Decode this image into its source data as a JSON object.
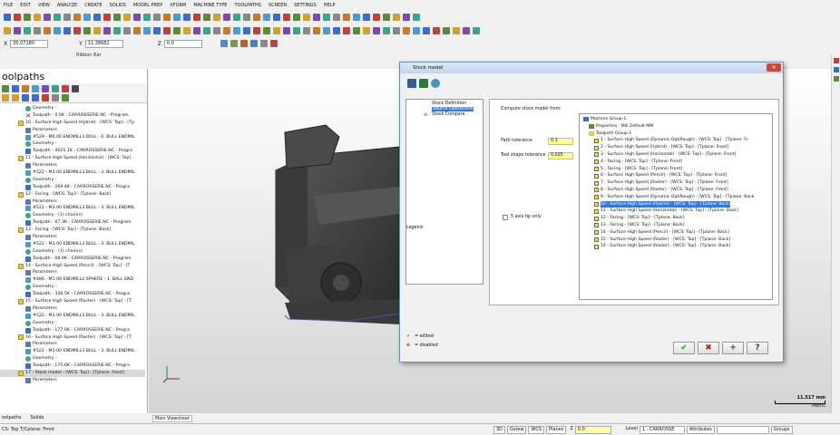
{
  "menu": [
    "FILE",
    "EDIT",
    "VIEW",
    "ANALYZE",
    "CREATE",
    "SOLIDS",
    "MODEL PREP",
    "XFORM",
    "MACHINE TYPE",
    "TOOLPATHS",
    "SCREEN",
    "SETTINGS",
    "HELP"
  ],
  "coords": {
    "x_label": "X",
    "x_value": "35.07180",
    "y_label": "Y",
    "y_value": "11.38682",
    "z_label": "Z",
    "z_value": "0.0"
  },
  "ribbon_label": "Ribbon Bar",
  "left_panel": {
    "title": "oolpaths",
    "tree": [
      {
        "icon": "geo",
        "indent": 28,
        "text": "Geometry -"
      },
      {
        "icon": "x",
        "indent": 28,
        "text": "Toolpath - 0.0K - CARROSSERIE.NC - Program"
      },
      {
        "icon": "folder",
        "indent": 20,
        "text": "10 - Surface High Speed (Hybrid) - [WCS: Top] - [Tp"
      },
      {
        "icon": "param",
        "indent": 28,
        "text": "Parameters"
      },
      {
        "icon": "tool",
        "indent": 28,
        "text": "#529 - M6.00 ENDMILL3 BULL - 6. BULL ENDMIL"
      },
      {
        "icon": "geo",
        "indent": 28,
        "text": "Geometry -"
      },
      {
        "icon": "path",
        "indent": 28,
        "text": "Toolpath - 4025.1K - CARROSSERIE.NC - Progra"
      },
      {
        "icon": "folder",
        "indent": 20,
        "text": "11 - Surface High Speed (Horizontal) - [WCS: Top] -"
      },
      {
        "icon": "param",
        "indent": 28,
        "text": "Parameters"
      },
      {
        "icon": "tool",
        "indent": 28,
        "text": "#522 - M3.00 ENDMILL3 BULL - 3. BULL ENDMIL"
      },
      {
        "icon": "geo",
        "indent": 28,
        "text": "Geometry -"
      },
      {
        "icon": "path",
        "indent": 28,
        "text": "Toolpath - 269.4K - CARROSSERIE.NC - Progra"
      },
      {
        "icon": "folder",
        "indent": 20,
        "text": "12 - Facing - [WCS: Top] - [Tplane: Back]"
      },
      {
        "icon": "param",
        "indent": 28,
        "text": "Parameters"
      },
      {
        "icon": "tool",
        "indent": 28,
        "text": "#522 - M3.00 ENDMILL3 BULL - 3. BULL ENDMIL"
      },
      {
        "icon": "geo",
        "indent": 28,
        "text": "Geometry - (1) chain(s)"
      },
      {
        "icon": "path",
        "indent": 28,
        "text": "Toolpath - 67.3K - CARROSSERIE.NC - Program"
      },
      {
        "icon": "folder",
        "indent": 20,
        "text": "13 - Facing - [WCS: Top] - [Tplane: Back]"
      },
      {
        "icon": "param",
        "indent": 28,
        "text": "Parameters"
      },
      {
        "icon": "tool",
        "indent": 28,
        "text": "#522 - M3.00 ENDMILL3 BULL - 3. BULL ENDMIL"
      },
      {
        "icon": "geo",
        "indent": 28,
        "text": "Geometry - (1) chain(s)"
      },
      {
        "icon": "path",
        "indent": 28,
        "text": "Toolpath - 68.9K - CARROSSERIE.NC - Program"
      },
      {
        "icon": "folder",
        "indent": 20,
        "text": "14 - Surface High Speed (Pencil) - [WCS: Top] - [T"
      },
      {
        "icon": "param",
        "indent": 28,
        "text": "Parameters"
      },
      {
        "icon": "tool",
        "indent": 28,
        "text": "#486 - M1.00 ENDMILL2 SPHERE - 1. BALL END"
      },
      {
        "icon": "geo",
        "indent": 28,
        "text": "Geometry -"
      },
      {
        "icon": "path",
        "indent": 28,
        "text": "Toolpath - 336.5K - CARROSSERIE.NC - Progra"
      },
      {
        "icon": "folder",
        "indent": 20,
        "text": "15 - Surface High Speed (Raster) - [WCS: Top] - [T"
      },
      {
        "icon": "param",
        "indent": 28,
        "text": "Parameters"
      },
      {
        "icon": "tool",
        "indent": 28,
        "text": "#522 - M3.00 ENDMILL3 BULL - 3. BULL ENDMIL"
      },
      {
        "icon": "geo",
        "indent": 28,
        "text": "Geometry -"
      },
      {
        "icon": "path",
        "indent": 28,
        "text": "Toolpath - 177.0K - CARROSSERIE.NC - Progra"
      },
      {
        "icon": "folder",
        "indent": 20,
        "text": "16 - Surface High Speed (Raster) - [WCS: Top] - [T"
      },
      {
        "icon": "param",
        "indent": 28,
        "text": "Parameters"
      },
      {
        "icon": "tool",
        "indent": 28,
        "text": "#522 - M3.00 ENDMILL3 BULL - 3. BULL ENDMIL"
      },
      {
        "icon": "geo",
        "indent": 28,
        "text": "Geometry -"
      },
      {
        "icon": "path",
        "indent": 28,
        "text": "Toolpath - 175.6K - CARROSSERIE.NC - Progra"
      },
      {
        "icon": "folder",
        "indent": 20,
        "text": "17 - Stock model - [WCS: Top] - [Tplane: Front]",
        "selected": true
      },
      {
        "icon": "param",
        "indent": 28,
        "text": "Parameters"
      }
    ],
    "tabs": [
      "oolpaths",
      "Solids"
    ]
  },
  "viewport_tab": "Main Viewsheet",
  "dialog": {
    "title": "Stock model",
    "close": "✕",
    "nav": [
      {
        "label": "Stock Definition",
        "sel": false
      },
      {
        "label": "Source Operations",
        "sel": true
      },
      {
        "label": "Stock Compare",
        "sel": false,
        "disabled": true
      }
    ],
    "legend_label": "Legend:",
    "legend_edited": "= edited",
    "legend_disabled": "= disabled",
    "compute_label": "Compute stock model from:",
    "path_tol_label": "Path tolerance",
    "path_tol_value": "0.1",
    "tool_shape_label": "Tool shape tolerance",
    "tool_shape_value": "0.025",
    "axis_only_label": "5 axis tip only",
    "ops_tree": [
      {
        "type": "root",
        "indent": 4,
        "text": "Machine Group-1"
      },
      {
        "type": "props",
        "indent": 10,
        "text": "Properties - Mill Default MM"
      },
      {
        "type": "group",
        "indent": 10,
        "text": "Toolpath Group-1"
      },
      {
        "type": "op",
        "indent": 16,
        "text": "1 - Surface High Speed (Dynamic OptiRough) - [WCS: Top] - [Tplane: Fr"
      },
      {
        "type": "op",
        "indent": 16,
        "text": "2 - Surface High Speed (Hybrid) - [WCS: Top] - [Tplane: Front]"
      },
      {
        "type": "op",
        "indent": 16,
        "text": "3 - Surface High Speed (Horizontal) - [WCS: Top] - [Tplane: Front]"
      },
      {
        "type": "op",
        "indent": 16,
        "text": "4 - Facing - [WCS: Top] - [Tplane: Front]"
      },
      {
        "type": "op",
        "indent": 16,
        "text": "5 - Facing - [WCS: Top] - [Tplane: Front]"
      },
      {
        "type": "op",
        "indent": 16,
        "text": "6 - Surface High Speed (Pencil) - [WCS: Top] - [Tplane: Front]"
      },
      {
        "type": "op",
        "indent": 16,
        "text": "7 - Surface High Speed (Raster) - [WCS: Top] - [Tplane: Front]"
      },
      {
        "type": "op",
        "indent": 16,
        "text": "8 - Surface High Speed (Raster) - [WCS: Top] - [Tplane: Front]"
      },
      {
        "type": "op",
        "indent": 16,
        "text": "9 - Surface High Speed (Dynamic OptiRough) - [WCS: Top] - [Tplane: Back"
      },
      {
        "type": "op",
        "indent": 16,
        "text": "10 - Surface High Speed (Hybrid) - [WCS: Top] - [Tplane: Back]",
        "sel": true
      },
      {
        "type": "op",
        "indent": 16,
        "text": "11 - Surface High Speed (Horizontal) - [WCS: Top] - [Tplane: Back]"
      },
      {
        "type": "op",
        "indent": 16,
        "text": "12 - Facing - [WCS: Top] - [Tplane: Back]"
      },
      {
        "type": "op",
        "indent": 16,
        "text": "13 - Facing - [WCS: Top] - [Tplane: Back]"
      },
      {
        "type": "op",
        "indent": 16,
        "text": "14 - Surface High Speed (Pencil) - [WCS: Top] - [Tplane: Back]"
      },
      {
        "type": "op",
        "indent": 16,
        "text": "15 - Surface High Speed (Raster) - [WCS: Top] - [Tplane: Back]"
      },
      {
        "type": "op",
        "indent": 16,
        "text": "16 - Surface High Speed (Raster) - [WCS: Top] - [Tplane: Back]"
      }
    ],
    "ok": "✔",
    "cancel": "✖",
    "add": "+",
    "help": "?"
  },
  "scale": {
    "value": "11.517 mm",
    "unit": "Metric"
  },
  "status": {
    "left_text": "CS: Top  T/Cplane: Front",
    "btn_3d": "3D",
    "gview": "Gview",
    "wcs": "WCS",
    "planes": "Planes",
    "z_label": "Z",
    "z_value": "0.0",
    "level_label": "Level",
    "level_value": "1 : CARROSSE",
    "attributes": "Attributes",
    "groups": "Groups"
  },
  "colors": {
    "dialog_border": "#6a8cb5",
    "selection": "#3a78d0",
    "tolerance_field": "#ffff99",
    "ok": "#1f9a1f",
    "cancel": "#c31a1a"
  }
}
